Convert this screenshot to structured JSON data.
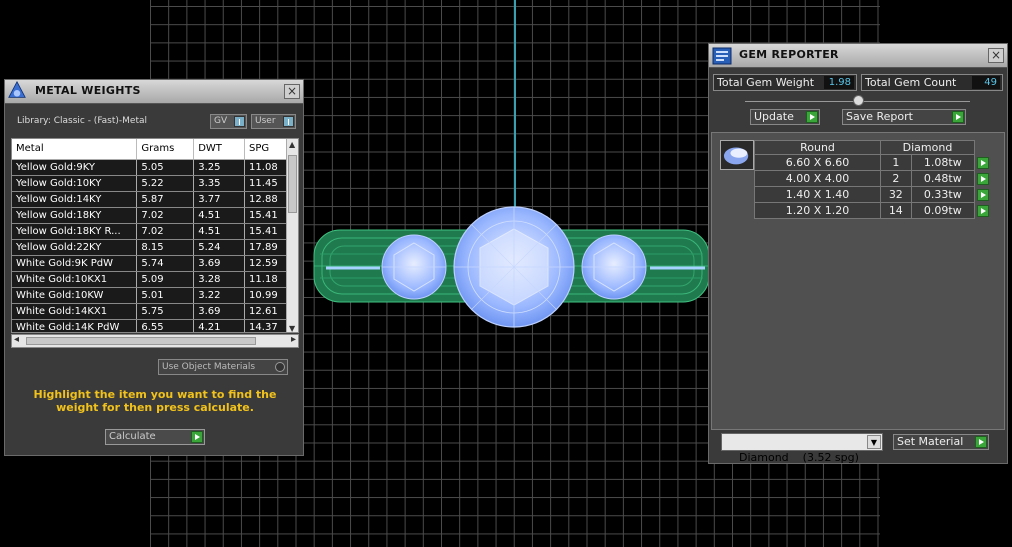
{
  "metal_weights": {
    "title": "METAL WEIGHTS",
    "library_label": "Library: Classic - (Fast)-Metal",
    "gv_label": "GV",
    "user_label": "User",
    "columns": [
      "Metal",
      "Grams",
      "DWT",
      "SPG"
    ],
    "rows": [
      {
        "metal": "Yellow Gold:9KY",
        "grams": "5.05",
        "dwt": "3.25",
        "spg": "11.08"
      },
      {
        "metal": "Yellow Gold:10KY",
        "grams": "5.22",
        "dwt": "3.35",
        "spg": "11.45"
      },
      {
        "metal": "Yellow Gold:14KY",
        "grams": "5.87",
        "dwt": "3.77",
        "spg": "12.88"
      },
      {
        "metal": "Yellow Gold:18KY",
        "grams": "7.02",
        "dwt": "4.51",
        "spg": "15.41"
      },
      {
        "metal": "Yellow Gold:18KY R...",
        "grams": "7.02",
        "dwt": "4.51",
        "spg": "15.41"
      },
      {
        "metal": "Yellow Gold:22KY",
        "grams": "8.15",
        "dwt": "5.24",
        "spg": "17.89"
      },
      {
        "metal": "White Gold:9K PdW",
        "grams": "5.74",
        "dwt": "3.69",
        "spg": "12.59"
      },
      {
        "metal": "White Gold:10KX1",
        "grams": "5.09",
        "dwt": "3.28",
        "spg": "11.18"
      },
      {
        "metal": "White Gold:10KW",
        "grams": "5.01",
        "dwt": "3.22",
        "spg": "10.99"
      },
      {
        "metal": "White Gold:14KX1",
        "grams": "5.75",
        "dwt": "3.69",
        "spg": "12.61"
      },
      {
        "metal": "White Gold:14K PdW",
        "grams": "6.55",
        "dwt": "4.21",
        "spg": "14.37"
      }
    ],
    "use_object_materials": "Use Object Materials",
    "instruction": "Highlight the item you want to find the weight for then press calculate.",
    "calculate_label": "Calculate"
  },
  "gem_reporter": {
    "title": "GEM REPORTER",
    "total_weight_label": "Total Gem Weight",
    "total_weight_value": "1.98",
    "total_count_label": "Total Gem Count",
    "total_count_value": "49",
    "update_label": "Update",
    "save_report_label": "Save Report",
    "col_shape": "Round",
    "col_material": "Diamond",
    "gems": [
      {
        "size": "6.60 X 6.60",
        "count": "1",
        "weight": "1.08tw"
      },
      {
        "size": "4.00 X 4.00",
        "count": "2",
        "weight": "0.48tw"
      },
      {
        "size": "1.40 X 1.40",
        "count": "32",
        "weight": "0.33tw"
      },
      {
        "size": "1.20 X 1.20",
        "count": "14",
        "weight": "0.09tw"
      }
    ],
    "material_select": "Diamond    (3.52 spg)",
    "set_material_label": "Set Material"
  },
  "colors": {
    "accent_yellow": "#f1c21b",
    "value_blue": "#58c4e8",
    "play_green": "#3aa63a",
    "model_blue": "#7fa8ff",
    "model_green": "#2fa86a"
  },
  "icons": [
    "metal-weights-app-icon",
    "gem-reporter-app-icon",
    "close-icon",
    "play-icon",
    "round-gem-icon",
    "dropdown-arrow-icon"
  ]
}
